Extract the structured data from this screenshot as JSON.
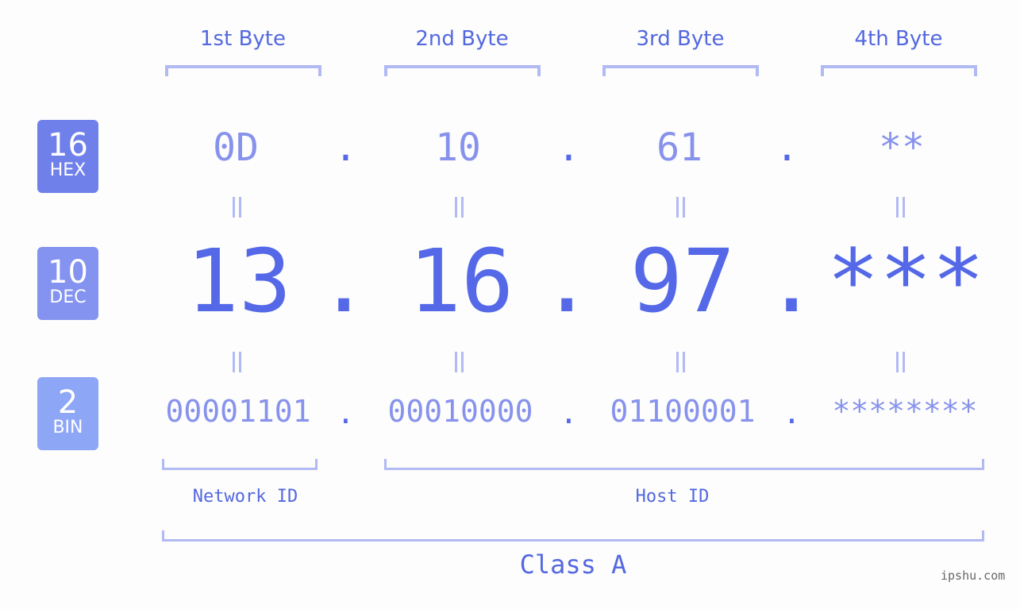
{
  "byte_headers": [
    "1st Byte",
    "2nd Byte",
    "3rd Byte",
    "4th Byte"
  ],
  "badges": [
    {
      "num": "16",
      "label": "HEX",
      "color": "#7080ea"
    },
    {
      "num": "10",
      "label": "DEC",
      "color": "#8492f0"
    },
    {
      "num": "2",
      "label": "BIN",
      "color": "#8da6f6"
    }
  ],
  "hex": [
    "0D",
    "10",
    "61",
    "**"
  ],
  "dec": [
    "13",
    "16",
    "97",
    "***"
  ],
  "bin": [
    "00001101",
    "00010000",
    "01100001",
    "********"
  ],
  "separator": ".",
  "network_id_label": "Network ID",
  "host_id_label": "Host ID",
  "class_label": "Class A",
  "watermark": "ipshu.com"
}
